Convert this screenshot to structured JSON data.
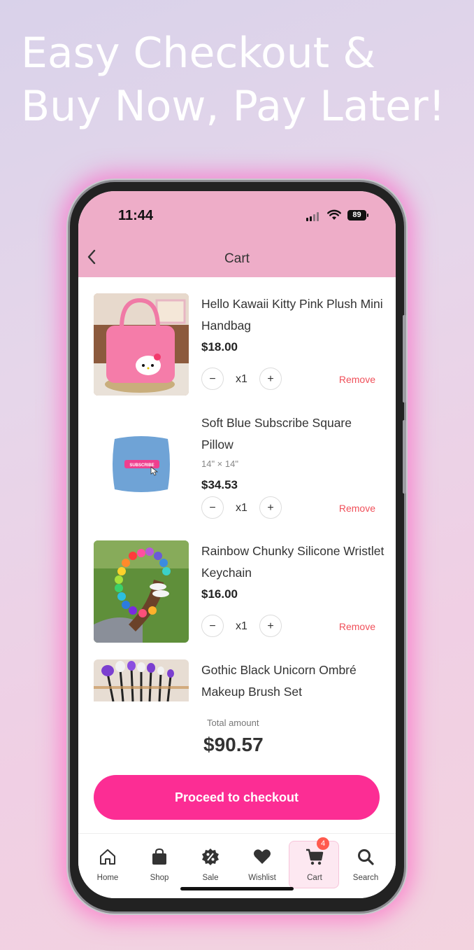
{
  "headline": {
    "line1": "Easy Checkout &",
    "line2": "Buy Now, Pay Later!"
  },
  "status_bar": {
    "time": "11:44",
    "battery": "89",
    "icons": [
      "signal-icon",
      "wifi-icon",
      "battery-icon"
    ]
  },
  "nav": {
    "title": "Cart",
    "back_icon": "chevron-left-icon"
  },
  "items": [
    {
      "name": "Hello Kawaii Kitty Pink Plush Mini Handbag",
      "variant": "",
      "price": "$18.00",
      "qty": "x1",
      "remove": "Remove",
      "minus": "−",
      "plus": "+"
    },
    {
      "name": "Soft Blue Subscribe Square Pillow",
      "variant": "14\" × 14\"",
      "price": "$34.53",
      "qty": "x1",
      "remove": "Remove",
      "minus": "−",
      "plus": "+",
      "image_text": "SUBSCRIBE"
    },
    {
      "name": "Rainbow Chunky Silicone Wristlet Keychain",
      "variant": "",
      "price": "$16.00",
      "qty": "x1",
      "remove": "Remove",
      "minus": "−",
      "plus": "+"
    },
    {
      "name": "Gothic Black Unicorn Ombré Makeup Brush Set"
    }
  ],
  "summary": {
    "total_label": "Total amount",
    "total_value": "$90.57",
    "checkout_label": "Proceed to checkout"
  },
  "tabbar": {
    "tabs": [
      {
        "label": "Home",
        "icon": "home-icon"
      },
      {
        "label": "Shop",
        "icon": "bag-icon"
      },
      {
        "label": "Sale",
        "icon": "discount-icon"
      },
      {
        "label": "Wishlist",
        "icon": "heart-icon"
      },
      {
        "label": "Cart",
        "icon": "cart-icon",
        "badge": "4",
        "active": true
      },
      {
        "label": "Search",
        "icon": "search-icon"
      }
    ]
  },
  "colors": {
    "accent": "#fc2d94",
    "topbar": "#eeadc8",
    "remove": "#f0505a"
  }
}
